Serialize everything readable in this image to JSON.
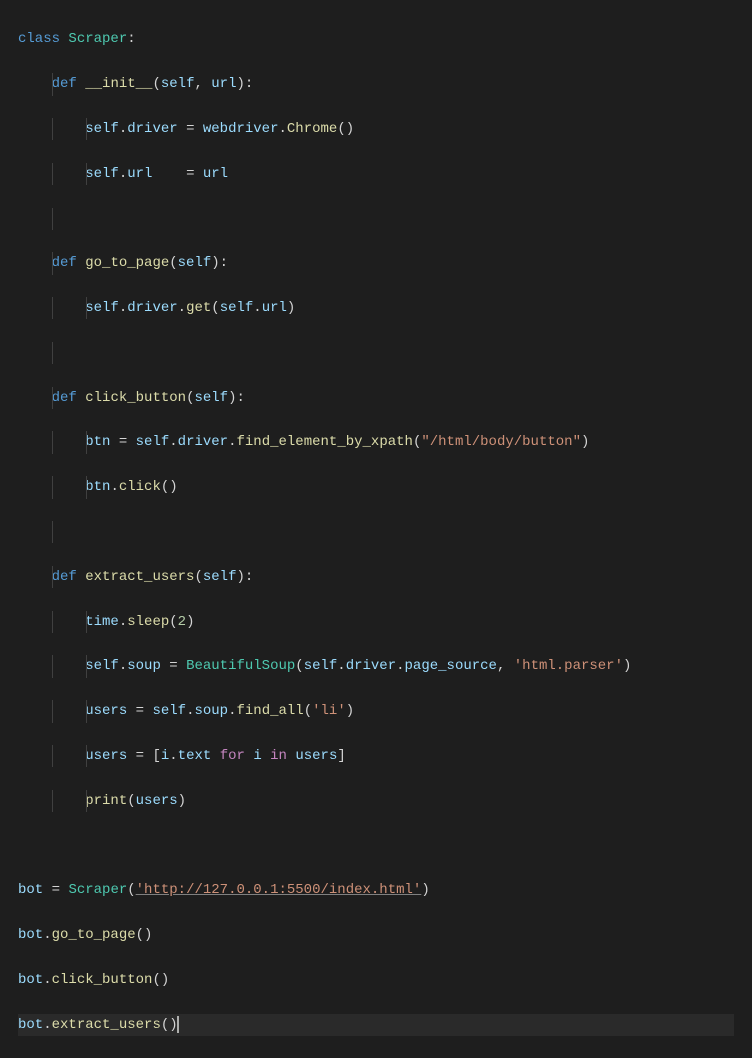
{
  "code": {
    "k_class": "class",
    "cls_scraper": "Scraper",
    "k_def": "def",
    "fn_init": "__init__",
    "p_self": "self",
    "p_url": "url",
    "attr_driver": "driver",
    "cls_webdriver": "webdriver",
    "fn_chrome": "Chrome",
    "attr_url": "url",
    "fn_go_to_page": "go_to_page",
    "fn_get": "get",
    "fn_click_button": "click_button",
    "var_btn": "btn",
    "fn_find_element_by_xpath": "find_element_by_xpath",
    "str_xpath": "\"/html/body/button\"",
    "fn_click": "click",
    "fn_extract_users": "extract_users",
    "mod_time": "time",
    "fn_sleep": "sleep",
    "num_2": "2",
    "attr_soup": "soup",
    "cls_bsoup": "BeautifulSoup",
    "attr_page_source": "page_source",
    "str_parser": "'html.parser'",
    "var_users": "users",
    "fn_find_all": "find_all",
    "str_li": "'li'",
    "var_i": "i",
    "attr_text": "text",
    "k_for": "for",
    "k_in": "in",
    "fn_print": "print",
    "var_bot": "bot",
    "str_url": "'http://127.0.0.1:5500/index.html'"
  }
}
